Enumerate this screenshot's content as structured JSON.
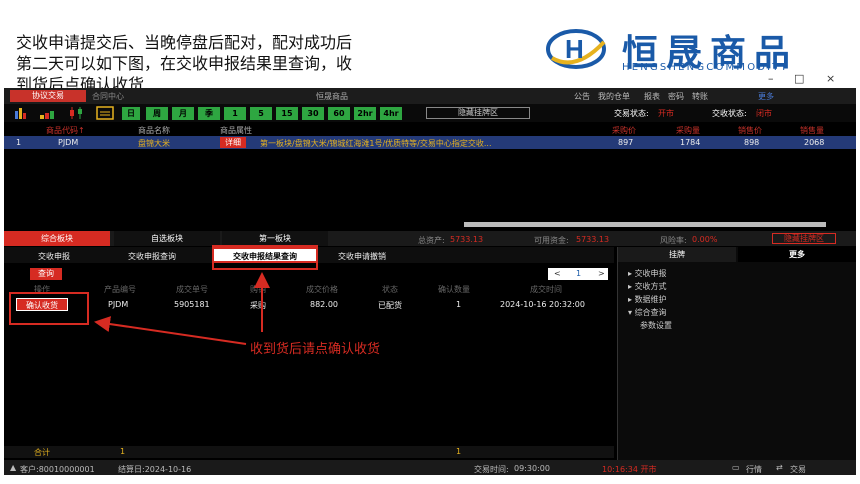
{
  "intro": {
    "line1": "交收申请提交后、当晚停盘后配对，配对成功后",
    "line2": "第二天可以如下图，在交收申报结果里查询，收",
    "line3": "到货后点确认收货"
  },
  "brand": {
    "cn": "恒晟商品",
    "en": "HENGSHENGCOMMODITY",
    "logo_letter": "H"
  },
  "window_controls": {
    "min": "–",
    "max": "□",
    "close": "×"
  },
  "menubar": {
    "active_tab": "协议交易",
    "tab2": "合同中心",
    "app_title": "恒晟商品",
    "links": [
      "公告",
      "我的仓单",
      "报表",
      "密码",
      "转账"
    ],
    "more": "更多"
  },
  "toolbar": {
    "periods": [
      "日",
      "周",
      "月",
      "季",
      "1",
      "5",
      "15",
      "30",
      "60",
      "2hr",
      "4hr"
    ],
    "hide_button": "隐藏挂牌区",
    "trade_status_label": "交易状态:",
    "trade_status": "开市",
    "delivery_status_label": "交收状态:",
    "delivery_status": "闭市"
  },
  "grid": {
    "headers": [
      "商品代码↑",
      "商品名称",
      "商品属性",
      "采购价",
      "采购量",
      "销售价",
      "销售量"
    ],
    "row": {
      "idx": "1",
      "code": "PJDM",
      "name": "盘锦大米",
      "detail": "详细",
      "attr": "第一板块/盘锦大米/锦城红海滩1号/优质特等/交易中心指定交收...",
      "buy_price": "897",
      "buy_qty": "1784",
      "sell_price": "898",
      "sell_qty": "2068"
    }
  },
  "boards": {
    "tabs": [
      "综合板块",
      "自选板块",
      "第一板块"
    ],
    "total_assets_label": "总资产:",
    "total_assets": "5733.13",
    "available_label": "可用资金:",
    "available": "5733.13",
    "risk_label": "风险率:",
    "risk": "0.00%",
    "hide_button": "隐藏挂牌区"
  },
  "subtabs": [
    "交收申报",
    "交收申报查询",
    "交收申报结果查询",
    "交收申请撤销"
  ],
  "query_button": "查询",
  "pager": {
    "prev": "<",
    "page": "1",
    "next": ">"
  },
  "result_table": {
    "headers": [
      "操作",
      "产品编号",
      "成交单号",
      "购销",
      "成交价格",
      "状态",
      "确认数量",
      "成交时间"
    ],
    "row": {
      "action": "确认收货",
      "product": "PJDM",
      "order": "5905181",
      "side": "采购",
      "price": "882.00",
      "status": "已配货",
      "qty": "1",
      "time": "2024-10-16 20:32:00"
    }
  },
  "annotation": "收到货后请点确认收货",
  "right_panel": {
    "tabs": [
      "挂牌",
      "更多"
    ],
    "menu": [
      "交收申报",
      "交收方式",
      "数据维护",
      "综合查询",
      "参数设置"
    ]
  },
  "totals": {
    "label": "合计",
    "count": "1",
    "qty": "1"
  },
  "statusbar": {
    "client": "客户:80010000001",
    "settle": "结算日:2024-10-16",
    "trade_time_label": "交易时间:",
    "trade_time": "09:30:00",
    "clock": "10:16:34 开市",
    "quotes": "行情",
    "trade": "交易"
  },
  "colors": {
    "accent_red": "#d62b22",
    "brand_blue": "#1a5aa8",
    "period_green": "#2ea641",
    "row_blue": "#243a78"
  }
}
